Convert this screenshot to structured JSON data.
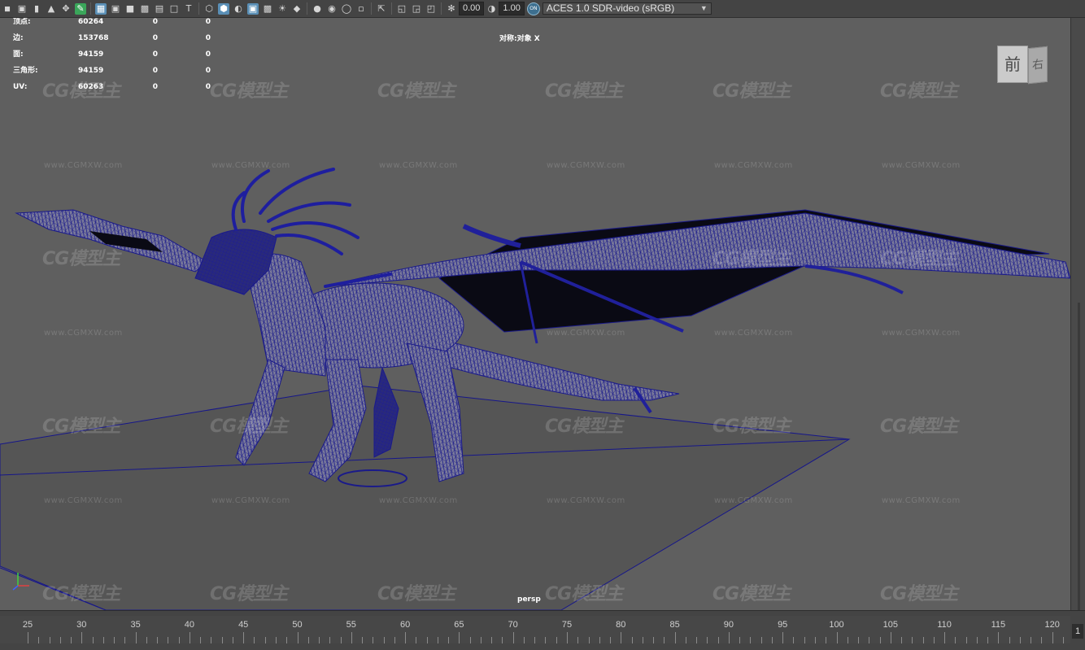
{
  "toolbar": {
    "icons": [
      "camera-icon",
      "camera-attributes-icon",
      "bookmark-icon",
      "image-plane-icon",
      "grid-icon",
      "film-gate-icon",
      "resolution-gate-icon",
      "gate-mask-icon",
      "field-chart-icon",
      "safe-action-icon",
      "safe-title-icon",
      "wireframe-icon",
      "smooth-shade-icon",
      "default-material-icon",
      "textured-icon",
      "lighting-icon",
      "shadows-icon",
      "ambient-occlusion-icon",
      "motion-blur-icon",
      "antialiasing-icon",
      "isolate-select-icon",
      "xray-icon",
      "xray-joints-icon",
      "backface-icon",
      "exposure-icon",
      "gamma-icon",
      "color-management-icon"
    ],
    "exposure_value": "0.00",
    "gamma_value": "1.00",
    "aces_badge": "ON",
    "color_space": "ACES 1.0 SDR-video (sRGB)"
  },
  "hud": {
    "rows": [
      {
        "label": "顶点:",
        "v1": "60264",
        "v2": "0",
        "v3": "0"
      },
      {
        "label": "边:",
        "v1": "153768",
        "v2": "0",
        "v3": "0"
      },
      {
        "label": "面:",
        "v1": "94159",
        "v2": "0",
        "v3": "0"
      },
      {
        "label": "三角形:",
        "v1": "94159",
        "v2": "0",
        "v3": "0"
      },
      {
        "label": "UV:",
        "v1": "60263",
        "v2": "0",
        "v3": "0"
      }
    ],
    "symmetry": "对称:对象 X",
    "camera": "persp"
  },
  "viewcube": {
    "front": "前",
    "right": "右"
  },
  "watermark": {
    "logo": "CG模型主",
    "url": "www.CGMXW.com"
  },
  "timeslider": {
    "labels": [
      "25",
      "30",
      "35",
      "40",
      "45",
      "50",
      "55",
      "60",
      "65",
      "70",
      "75",
      "80",
      "85",
      "90",
      "95",
      "100",
      "105",
      "110",
      "115",
      "120"
    ],
    "current_frame": "1"
  },
  "colors": {
    "wire": "#1a1a8a",
    "viewport_bg": "#5f5f5f"
  }
}
